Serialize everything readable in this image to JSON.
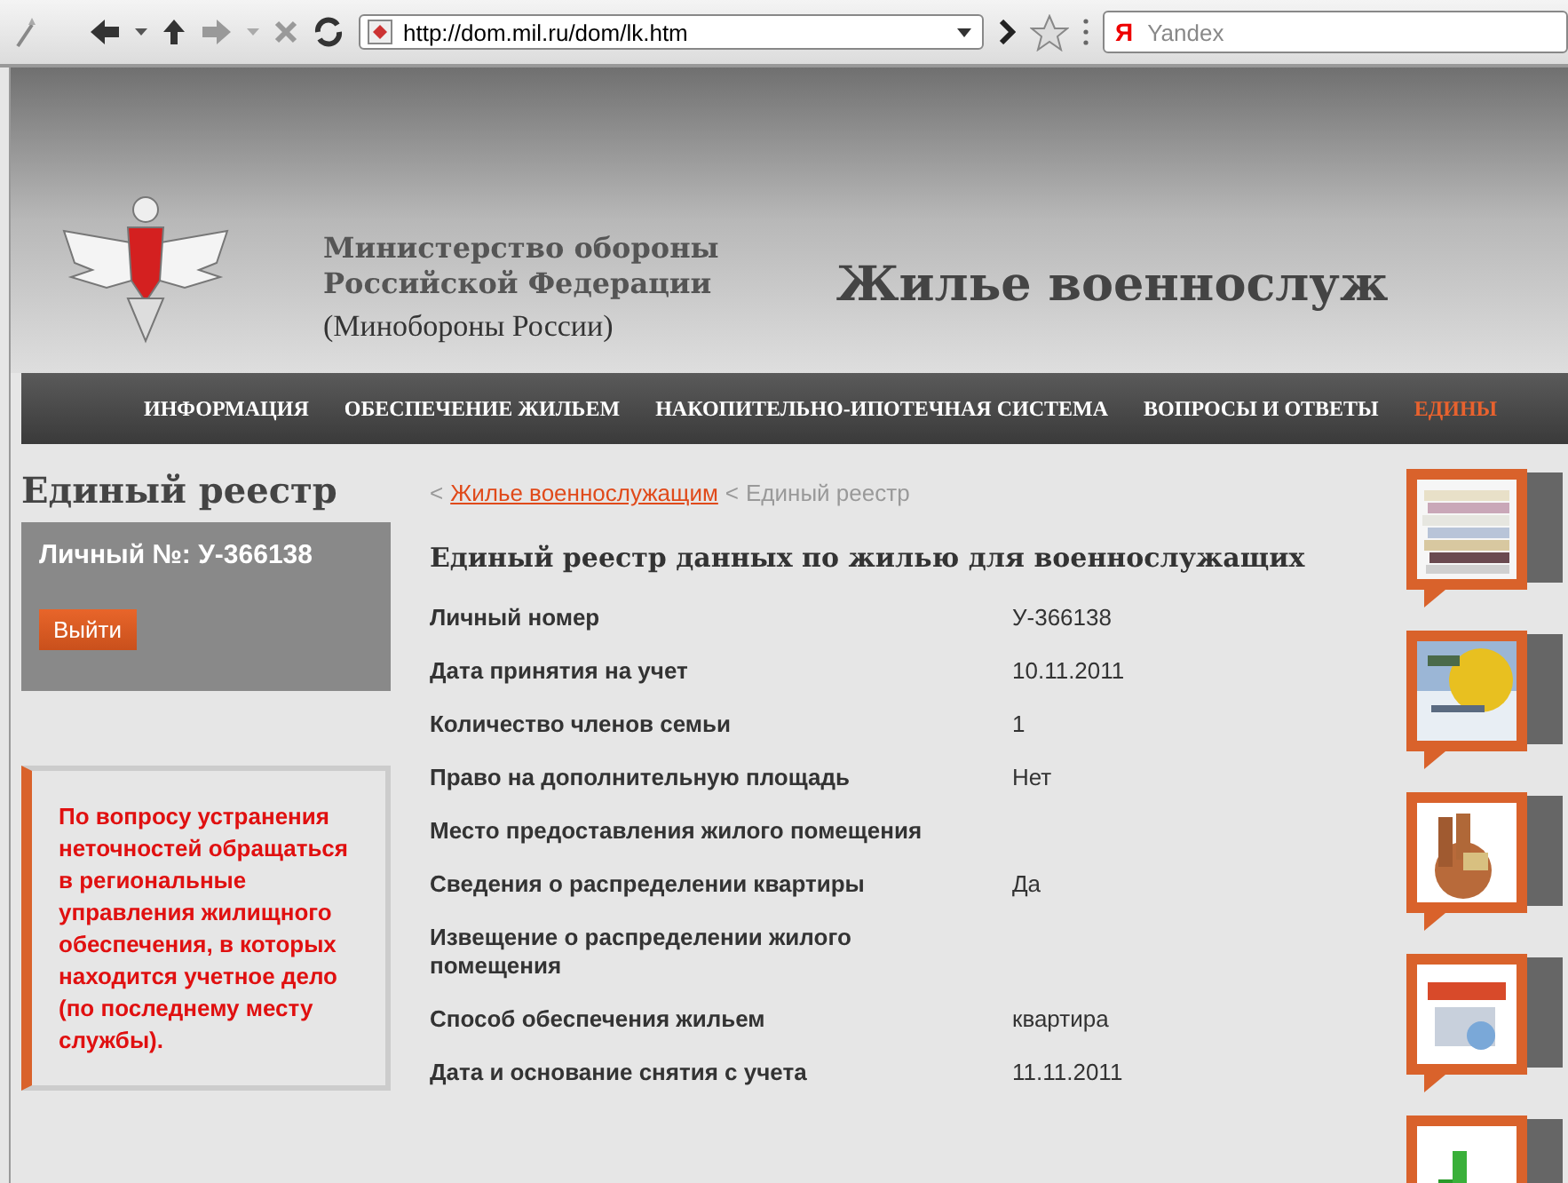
{
  "browser": {
    "url": "http://dom.mil.ru/dom/lk.htm",
    "search_logo": "Я",
    "search_placeholder": "Yandex"
  },
  "header": {
    "org_line1": "Министерство обороны",
    "org_line2": "Российской Федерации",
    "org_short": "(Минобороны России)",
    "site_title": "Жилье военнослуж"
  },
  "nav": [
    {
      "label": "ИНФОРМАЦИЯ",
      "selected": false
    },
    {
      "label": "ОБЕСПЕЧЕНИЕ ЖИЛЬЕМ",
      "selected": false
    },
    {
      "label": "НАКОПИТЕЛЬНО-ИПОТЕЧНАЯ СИСТЕМА",
      "selected": false
    },
    {
      "label": "ВОПРОСЫ И ОТВЕТЫ",
      "selected": false
    },
    {
      "label": "ЕДИНЫ",
      "selected": true
    }
  ],
  "sidebar": {
    "title": "Единый реестр",
    "personal_no": "Личный №: У-366138",
    "logout": "Выйти",
    "note": "По вопросу устранения неточностей обращаться в региональные управления жилищного обеспечения, в которых находится учетное дело (по последнему месту службы)."
  },
  "breadcrumb": {
    "sep1": "<",
    "link": "Жилье военнослужащим",
    "sep2": "<",
    "current": "Единый реестр"
  },
  "main_title": "Единый реестр данных по жилью для военнослужащих",
  "rows": [
    {
      "label": "Личный номер",
      "value": "У-366138"
    },
    {
      "label": "Дата принятия на учет",
      "value": "10.11.2011"
    },
    {
      "label": "Количество членов семьи",
      "value": "1"
    },
    {
      "label": "Право на дополнительную площадь",
      "value": "Нет"
    },
    {
      "label": "Место предоставления жилого помещения",
      "value": ""
    },
    {
      "label": "Сведения о распределении квартиры",
      "value": "Да"
    },
    {
      "label": "Извещение о распределении жилого помещения",
      "value": ""
    },
    {
      "label": "Способ обеспечения жильем",
      "value": "квартира"
    },
    {
      "label": "Дата и основание снятия с учета",
      "value": "11.11.2011"
    }
  ]
}
